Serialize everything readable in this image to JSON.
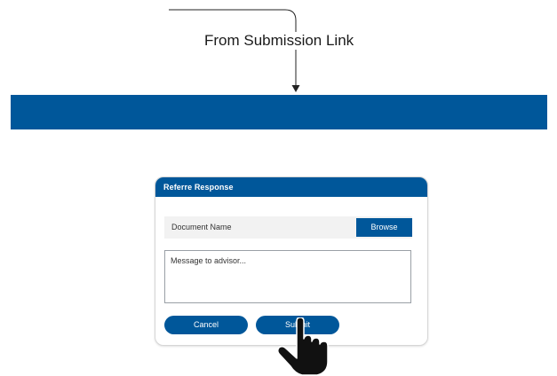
{
  "flow": {
    "label": "From Submission Link"
  },
  "banner": {
    "color": "#00579a"
  },
  "dialog": {
    "title": "Referre Response",
    "document_label": "Document Name",
    "browse_label": "Browse",
    "message_placeholder": "Message to advisor...",
    "cancel_label": "Cancel",
    "submit_label": "Submit"
  },
  "colors": {
    "accent": "#00579a",
    "background": "#ffffff",
    "input_fill": "#f2f2f2"
  },
  "cursor": {
    "icon": "pointer-hand-icon"
  }
}
